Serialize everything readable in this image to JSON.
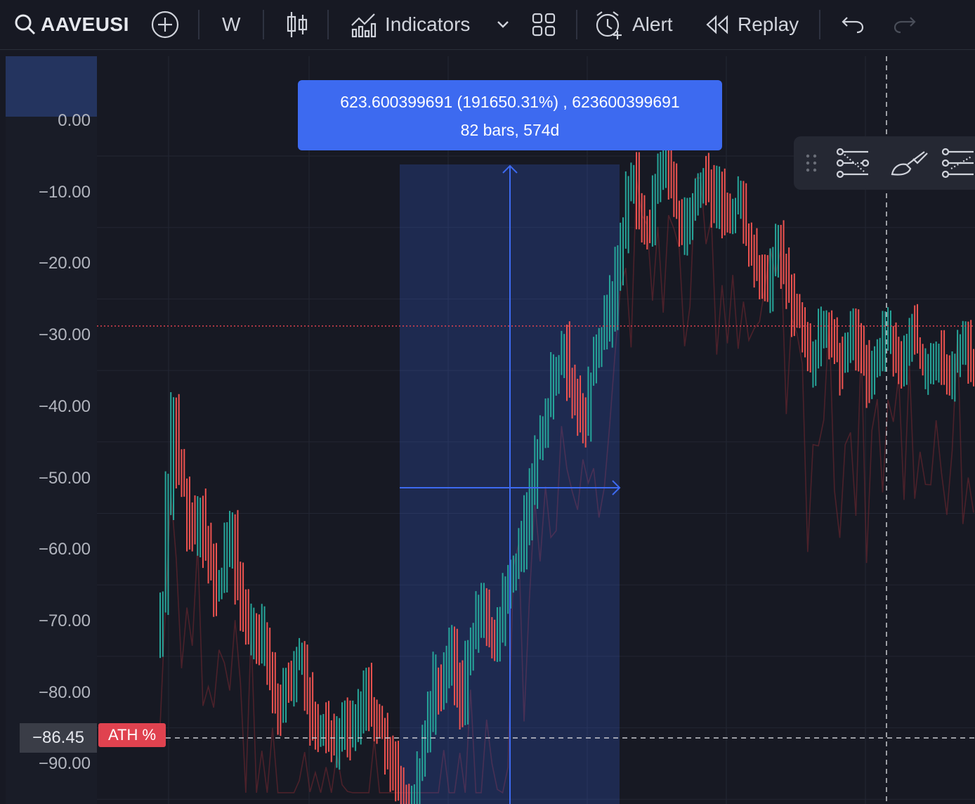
{
  "toolbar": {
    "symbol": "AAVEUSI",
    "interval": "W",
    "indicators_label": "Indicators",
    "alert_label": "Alert",
    "replay_label": "Replay"
  },
  "price_scale": {
    "ticks": [
      "0.00",
      "−10.00",
      "−20.00",
      "−30.00",
      "−40.00",
      "−50.00",
      "−60.00",
      "−70.00",
      "−80.00",
      "−90.00"
    ],
    "crosshair_value": "−86.45",
    "ath_label": "ATH %"
  },
  "measure": {
    "line1": "623.600399691 (191650.31%) , 623600399691",
    "line2": "82 bars, 574d"
  },
  "colors": {
    "up": "#26a69a",
    "down": "#ef5350",
    "measure": "#3d6af0",
    "ath_line": "#e0424f"
  },
  "chart_data": {
    "type": "line",
    "description_series": "weekly candles, percent below all-time high",
    "ylim": [
      -95,
      3
    ],
    "grid": true,
    "reference_levels": [
      {
        "name": "ATH %",
        "value": -86.45
      },
      {
        "value": -28.7
      }
    ],
    "close": [
      -68,
      -52,
      -40,
      -48,
      -52,
      -56,
      -58,
      -54,
      -60,
      -62,
      -66,
      -64,
      -60,
      -58,
      -66,
      -68,
      -72,
      -70,
      -74,
      -72,
      -76,
      -80,
      -82,
      -78,
      -80,
      -76,
      -74,
      -80,
      -84,
      -86,
      -84,
      -86,
      -87,
      -86,
      -85,
      -87,
      -84,
      -82,
      -80,
      -82,
      -84,
      -85,
      -88,
      -90,
      -92,
      -94,
      -96,
      -94,
      -90,
      -86,
      -82,
      -78,
      -80,
      -76,
      -74,
      -78,
      -82,
      -76,
      -72,
      -70,
      -68,
      -72,
      -74,
      -70,
      -66,
      -64,
      -62,
      -60,
      -56,
      -50,
      -46,
      -44,
      -40,
      -36,
      -34,
      -32,
      -36,
      -38,
      -40,
      -42,
      -36,
      -32,
      -30,
      -28,
      -26,
      -20,
      -16,
      -10,
      -8,
      -12,
      -14,
      -16,
      -10,
      -8,
      -6,
      -10,
      -12,
      -16,
      -14,
      -12,
      -10,
      -8,
      -10,
      -12,
      -10,
      -12,
      -14,
      -12,
      -10,
      -16,
      -18,
      -20,
      -22,
      -24,
      -20,
      -18,
      -22,
      -24,
      -26,
      -28,
      -30,
      -34,
      -32,
      -30,
      -28,
      -30,
      -32,
      -34,
      -32,
      -30,
      -32,
      -34,
      -36,
      -34,
      -32,
      -30,
      -30,
      -32,
      -34,
      -32,
      -30,
      -32,
      -34,
      -34,
      -33,
      -32,
      -34,
      -35,
      -34,
      -33,
      -32,
      -34,
      -35
    ]
  }
}
